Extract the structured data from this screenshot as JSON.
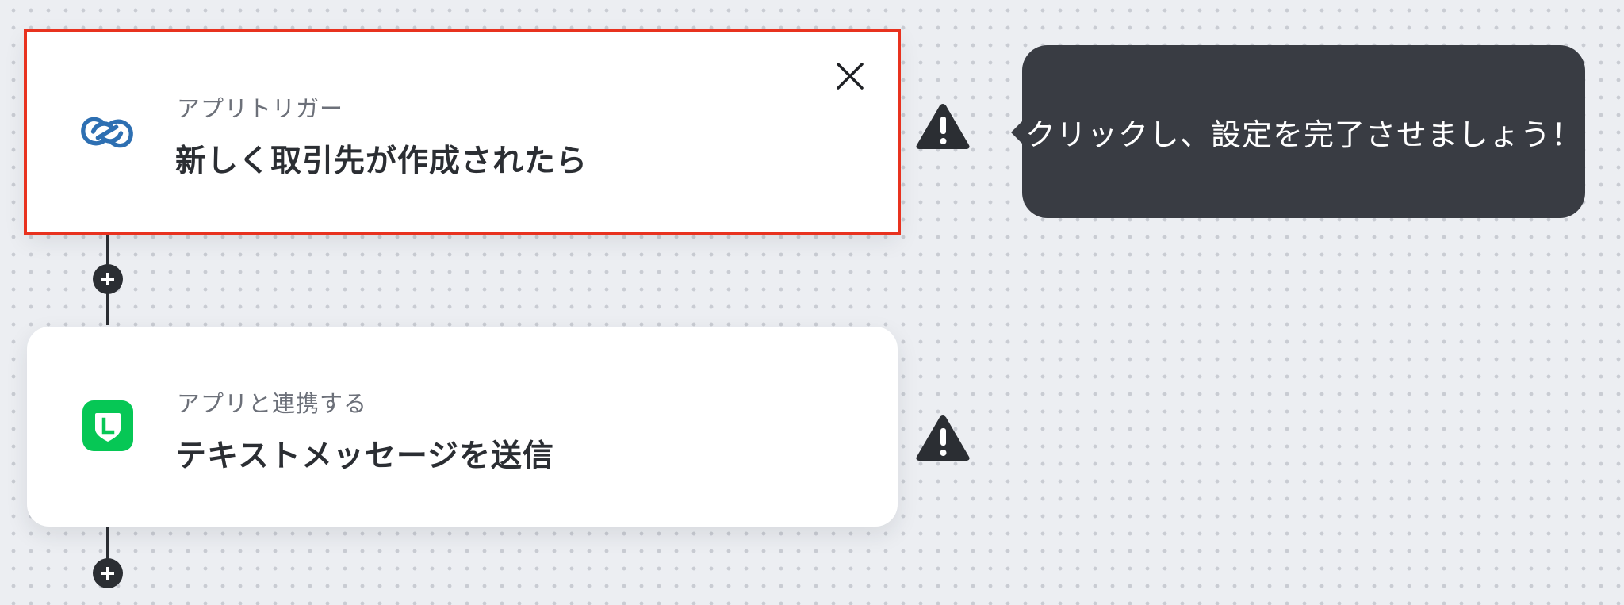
{
  "flow": {
    "steps": [
      {
        "kind_label": "アプリトリガー",
        "title": "新しく取引先が作成されたら",
        "app_icon": "zoho-crm-link-icon",
        "selected": true,
        "warning_icon": "warning-triangle-icon"
      },
      {
        "kind_label": "アプリと連携する",
        "title": "テキストメッセージを送信",
        "app_icon": "line-app-icon",
        "selected": false,
        "warning_icon": "warning-triangle-icon"
      }
    ],
    "add_step_icon": "plus-icon",
    "close_icon": "close-icon"
  },
  "tooltip": {
    "text": "クリックし、設定を完了させましょう！"
  },
  "colors": {
    "selected_outline": "#e8321f",
    "canvas_background": "#eceef2",
    "tooltip_background": "#393c43",
    "line_brand": "#06c755",
    "zoho_blue": "#2d6fb2",
    "connector": "#2b2e33"
  }
}
